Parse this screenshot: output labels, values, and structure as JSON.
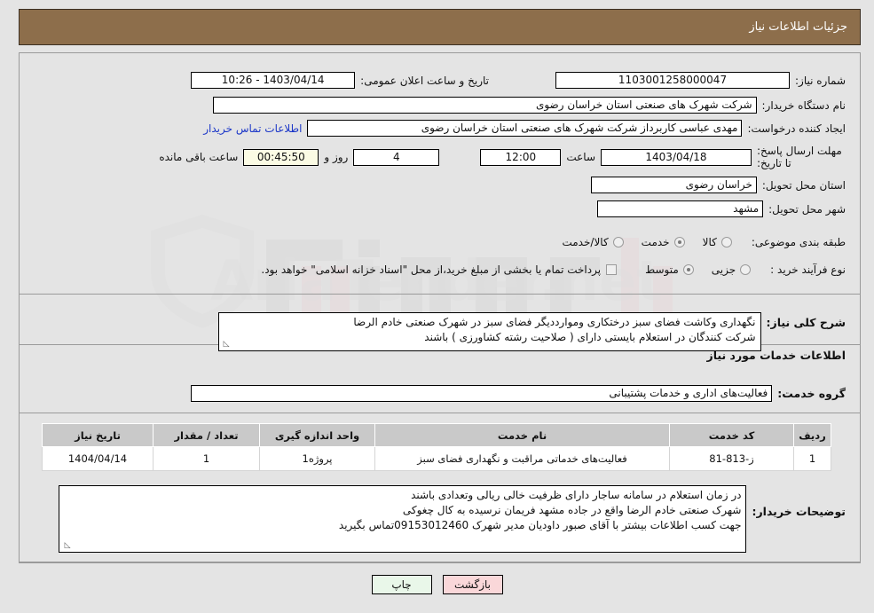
{
  "header": {
    "title": "جزئیات اطلاعات نیاز"
  },
  "watermark": {
    "text": "AriaTender.net"
  },
  "fields": {
    "need_number_label": "شماره نیاز:",
    "need_number_value": "1103001258000047",
    "announce_label": "تاریخ و ساعت اعلان عمومی:",
    "announce_value": "1403/04/14 - 10:26",
    "buyer_org_label": "نام دستگاه خریدار:",
    "buyer_org_value": "شرکت شهرک های صنعتی استان خراسان رضوی",
    "requester_label": "ایجاد کننده درخواست:",
    "requester_value": "مهدی عباسی کاربرداز شرکت شهرک های صنعتی استان خراسان رضوی",
    "contact_link": "اطلاعات تماس خریدار",
    "deadline_label": "مهلت ارسال پاسخ: تا تاریخ:",
    "deadline_date": "1403/04/18",
    "deadline_time_label": "ساعت",
    "deadline_time": "12:00",
    "remaining_days": "4",
    "remaining_days_label": "روز و",
    "remaining_clock": "00:45:50",
    "remaining_clock_label": "ساعت باقی مانده",
    "province_label": "استان محل تحویل:",
    "province_value": "خراسان رضوی",
    "city_label": "شهر محل تحویل:",
    "city_value": "مشهد",
    "category_label": "طبقه بندی موضوعی:",
    "process_label": "نوع فرآیند خرید :",
    "treasury_note": "پرداخت تمام یا بخشی از مبلغ خرید،از محل \"اسناد خزانه اسلامی\" خواهد بود."
  },
  "category_options": [
    {
      "label": "کالا",
      "selected": false
    },
    {
      "label": "خدمت",
      "selected": true
    },
    {
      "label": "کالا/خدمت",
      "selected": false
    }
  ],
  "process_options": [
    {
      "label": "جزیی",
      "selected": false
    },
    {
      "label": "متوسط",
      "selected": true
    }
  ],
  "description": {
    "label": "شرح کلی نیاز:",
    "line1": "نگهداری وکاشت فضای سبز درختکاری وموارددیگر فضای سبز در شهرک صنعتی خادم الرضا",
    "line2": "شرکت کنندگان در استعلام بایستی دارای  ( صلاحیت رشته کشاورزی ) باشند"
  },
  "services_section": {
    "title": "اطلاعات خدمات مورد نیاز",
    "group_label": "گروه خدمت:",
    "group_value": "فعالیت‌های اداری و خدمات پشتیبانی"
  },
  "table": {
    "columns": [
      "ردیف",
      "کد خدمت",
      "نام خدمت",
      "واحد اندازه گیری",
      "تعداد / مقدار",
      "تاریخ نیاز"
    ],
    "rows": [
      {
        "row_no": "1",
        "service_code": "ز-813-81",
        "service_name": "فعالیت‌های خدماتی مراقبت و نگهداری فضای سبز",
        "unit": "پروژه1",
        "quantity": "1",
        "need_date": "1404/04/14"
      }
    ]
  },
  "buyer_notes": {
    "label": "توضیحات خریدار:",
    "line1": "در زمان استعلام در سامانه ساجار دارای ظرفیت خالی ریالی وتعدادی باشند",
    "line2": "شهرک صنعتی خادم الرضا واقع در جاده مشهد فریمان نرسیده به کال چغوکی",
    "line3": "جهت کسب اطلاعات بیشتر با آقای صبور داودیان مدیر شهرک 09153012460تماس بگیرید"
  },
  "buttons": {
    "print": "چاپ",
    "back": "بازگشت"
  },
  "colors": {
    "header_bg": "#8d6e4b",
    "page_bg": "#e4e4e4",
    "link": "#1c37c8",
    "timer_bg": "#fbfbe4",
    "table_header_bg": "#c9c9c9",
    "print_btn_bg": "#e9f7e9",
    "back_btn_bg": "#fad7d9"
  }
}
